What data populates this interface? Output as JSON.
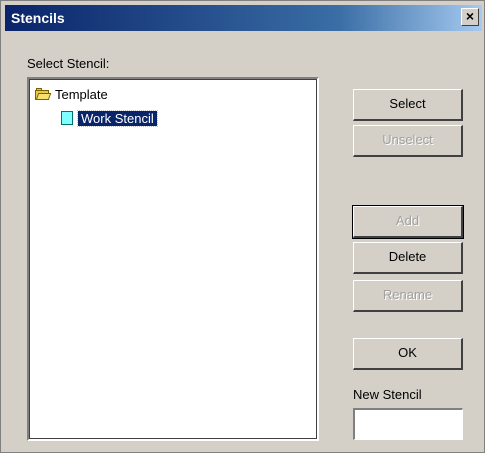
{
  "window": {
    "title": "Stencils",
    "close_glyph": "×"
  },
  "select_label": "Select Stencil:",
  "tree": {
    "root_label": "Template",
    "child_label": "Work Stencil"
  },
  "buttons": {
    "select": "Select",
    "unselect": "Unselect",
    "add": "Add",
    "delete": "Delete",
    "rename": "Rename",
    "ok": "OK"
  },
  "new_stencil_label": "New Stencil",
  "new_stencil_value": "",
  "icons": {
    "folder": "folder-icon",
    "stencil": "stencil-icon",
    "close": "close-icon"
  }
}
